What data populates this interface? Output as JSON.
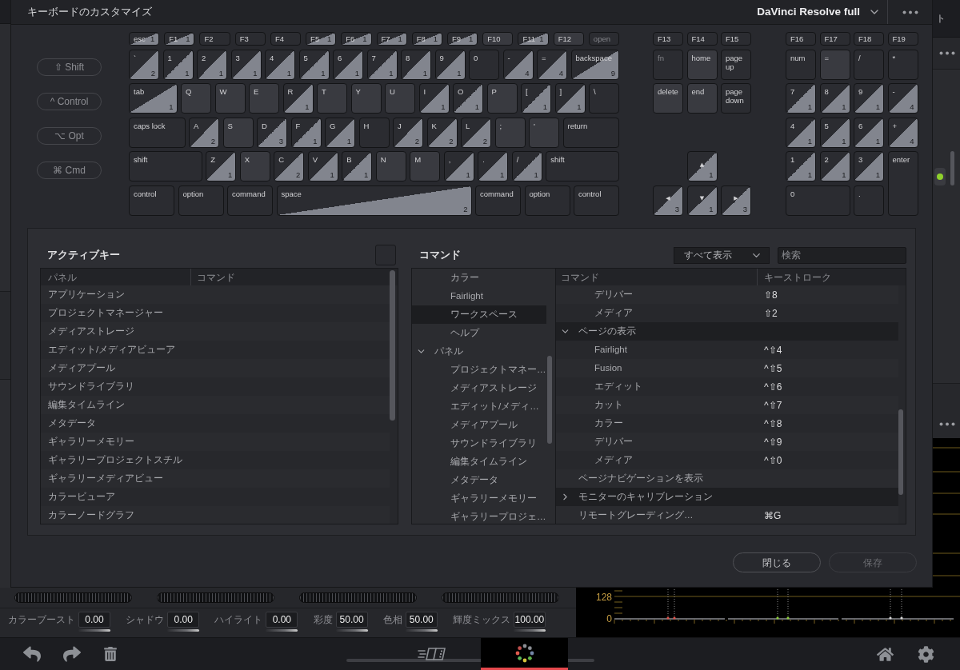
{
  "dialog": {
    "title": "キーボードのカスタマイズ",
    "preset": "DaVinci Resolve full",
    "modifiers": [
      {
        "label": "⇧ Shift",
        "selected": false
      },
      {
        "label": "^ Control",
        "selected": false
      },
      {
        "label": "⌥ Opt",
        "selected": false
      },
      {
        "label": "⌘ Cmd",
        "selected": false
      }
    ],
    "keyboard": {
      "main_rows": [
        [
          {
            "label": "esc",
            "kind": "mapped",
            "count": "1"
          },
          {
            "label": "F1",
            "kind": "mapped",
            "count": "1"
          },
          {
            "label": "F2",
            "kind": "plain"
          },
          {
            "label": "F3",
            "kind": "plain"
          },
          {
            "label": "F4",
            "kind": "plain"
          },
          {
            "label": "F5",
            "kind": "mapped",
            "count": "1"
          },
          {
            "label": "F6",
            "kind": "mapped",
            "count": "1"
          },
          {
            "label": "F7",
            "kind": "mapped",
            "count": "1"
          },
          {
            "label": "F8",
            "kind": "mapped",
            "count": "1"
          },
          {
            "label": "F9",
            "kind": "mapped",
            "count": "1"
          },
          {
            "label": "F10",
            "kind": "lit"
          },
          {
            "label": "F11",
            "kind": "mapped",
            "count": "1"
          },
          {
            "label": "F12",
            "kind": "lit"
          },
          {
            "label": "open",
            "kind": "off"
          }
        ],
        [
          {
            "label": "`",
            "kind": "mapped",
            "count": "2"
          },
          {
            "label": "1",
            "kind": "mapped",
            "count": "1"
          },
          {
            "label": "2",
            "kind": "mapped",
            "count": "1"
          },
          {
            "label": "3",
            "kind": "mapped",
            "count": "1"
          },
          {
            "label": "4",
            "kind": "mapped",
            "count": "1"
          },
          {
            "label": "5",
            "kind": "mapped",
            "count": "1"
          },
          {
            "label": "6",
            "kind": "mapped",
            "count": "1"
          },
          {
            "label": "7",
            "kind": "mapped",
            "count": "1"
          },
          {
            "label": "8",
            "kind": "mapped",
            "count": "1"
          },
          {
            "label": "9",
            "kind": "mapped",
            "count": "1"
          },
          {
            "label": "0",
            "kind": "plain"
          },
          {
            "label": "-",
            "kind": "mapped",
            "count": "4"
          },
          {
            "label": "=",
            "kind": "mapped",
            "count": "4"
          },
          {
            "label": "backspace",
            "kind": "mapped",
            "count": "9"
          }
        ],
        [
          {
            "label": "tab",
            "kind": "mapped",
            "count": "1"
          },
          {
            "label": "Q",
            "kind": "lit"
          },
          {
            "label": "W",
            "kind": "lit"
          },
          {
            "label": "E",
            "kind": "lit"
          },
          {
            "label": "R",
            "kind": "mapped",
            "count": "1"
          },
          {
            "label": "T",
            "kind": "lit"
          },
          {
            "label": "Y",
            "kind": "lit"
          },
          {
            "label": "U",
            "kind": "lit"
          },
          {
            "label": "I",
            "kind": "mapped",
            "count": "1"
          },
          {
            "label": "O",
            "kind": "mapped",
            "count": "1"
          },
          {
            "label": "P",
            "kind": "lit"
          },
          {
            "label": "[",
            "kind": "mapped",
            "count": "1"
          },
          {
            "label": "]",
            "kind": "mapped",
            "count": "1"
          },
          {
            "label": "\\",
            "kind": "plain"
          }
        ],
        [
          {
            "label": "caps lock",
            "kind": "plain"
          },
          {
            "label": "A",
            "kind": "mapped",
            "count": "2"
          },
          {
            "label": "S",
            "kind": "lit"
          },
          {
            "label": "D",
            "kind": "mapped",
            "count": "3"
          },
          {
            "label": "F",
            "kind": "mapped",
            "count": "1"
          },
          {
            "label": "G",
            "kind": "mapped",
            "count": "1"
          },
          {
            "label": "H",
            "kind": "plain"
          },
          {
            "label": "J",
            "kind": "mapped",
            "count": "2"
          },
          {
            "label": "K",
            "kind": "mapped",
            "count": "2"
          },
          {
            "label": "L",
            "kind": "mapped",
            "count": "2"
          },
          {
            "label": ";",
            "kind": "lit"
          },
          {
            "label": "'",
            "kind": "lit"
          },
          {
            "label": "return",
            "kind": "plain"
          }
        ],
        [
          {
            "label": "shift",
            "kind": "plain"
          },
          {
            "label": "Z",
            "kind": "mapped",
            "count": "1"
          },
          {
            "label": "X",
            "kind": "lit"
          },
          {
            "label": "C",
            "kind": "mapped",
            "count": "2"
          },
          {
            "label": "V",
            "kind": "mapped",
            "count": "1"
          },
          {
            "label": "B",
            "kind": "mapped",
            "count": "1"
          },
          {
            "label": "N",
            "kind": "lit"
          },
          {
            "label": "M",
            "kind": "lit"
          },
          {
            "label": ",",
            "kind": "mapped",
            "count": "1"
          },
          {
            "label": ".",
            "kind": "mapped",
            "count": "1"
          },
          {
            "label": "/",
            "kind": "mapped",
            "count": "1"
          },
          {
            "label": "shift",
            "kind": "plain"
          }
        ],
        [
          {
            "label": "control",
            "kind": "plain"
          },
          {
            "label": "option",
            "kind": "plain"
          },
          {
            "label": "command",
            "kind": "plain"
          },
          {
            "label": "space",
            "kind": "mapped",
            "count": "2"
          },
          {
            "label": "command",
            "kind": "plain"
          },
          {
            "label": "option",
            "kind": "plain"
          },
          {
            "label": "control",
            "kind": "plain"
          }
        ]
      ],
      "nav_keys": [
        {
          "label": "F13",
          "kind": "plain"
        },
        {
          "label": "F14",
          "kind": "plain"
        },
        {
          "label": "F15",
          "kind": "plain"
        },
        {
          "label": "fn",
          "kind": "off"
        },
        {
          "label": "home",
          "kind": "lit"
        },
        {
          "label": "page up",
          "kind": "plain"
        },
        {
          "label": "delete",
          "kind": "lit"
        },
        {
          "label": "end",
          "kind": "lit"
        },
        {
          "label": "page down",
          "kind": "plain"
        }
      ],
      "arrow_keys": [
        {
          "label": "▲",
          "kind": "mapped",
          "count": "1"
        },
        {
          "label": "◀",
          "kind": "mapped",
          "count": "3"
        },
        {
          "label": "▼",
          "kind": "mapped",
          "count": "1"
        },
        {
          "label": "▶",
          "kind": "mapped",
          "count": "3"
        }
      ],
      "keypad_keys": [
        {
          "label": "F16",
          "kind": "plain"
        },
        {
          "label": "F17",
          "kind": "plain"
        },
        {
          "label": "F18",
          "kind": "plain"
        },
        {
          "label": "F19",
          "kind": "plain"
        },
        {
          "label": "num",
          "kind": "plain"
        },
        {
          "label": "=",
          "kind": "lit"
        },
        {
          "label": "/",
          "kind": "plain"
        },
        {
          "label": "*",
          "kind": "plain"
        },
        {
          "label": "7",
          "kind": "mapped",
          "count": "1"
        },
        {
          "label": "8",
          "kind": "mapped",
          "count": "1"
        },
        {
          "label": "9",
          "kind": "mapped",
          "count": "1"
        },
        {
          "label": "-",
          "kind": "mapped",
          "count": "4"
        },
        {
          "label": "4",
          "kind": "mapped",
          "count": "1"
        },
        {
          "label": "5",
          "kind": "mapped",
          "count": "1"
        },
        {
          "label": "6",
          "kind": "mapped",
          "count": "1"
        },
        {
          "label": "+",
          "kind": "mapped",
          "count": "4"
        },
        {
          "label": "1",
          "kind": "mapped",
          "count": "1"
        },
        {
          "label": "2",
          "kind": "mapped",
          "count": "1"
        },
        {
          "label": "3",
          "kind": "mapped",
          "count": "1"
        },
        {
          "label": "enter",
          "kind": "plain"
        },
        {
          "label": "0",
          "kind": "plain"
        },
        {
          "label": ".",
          "kind": "plain"
        }
      ]
    },
    "active_keys": {
      "title": "アクティブキー",
      "columns": [
        "パネル",
        "コマンド"
      ],
      "rows": [
        "アプリケーション",
        "プロジェクトマネージャー",
        "メディアストレージ",
        "エディット/メディアビューア",
        "メディアプール",
        "サウンドライブラリ",
        "編集タイムライン",
        "メタデータ",
        "ギャラリーメモリー",
        "ギャラリープロジェクトスチル",
        "ギャラリーメディアビュー",
        "カラービューア",
        "カラーノードグラフ"
      ]
    },
    "commands": {
      "title": "コマンド",
      "filter": "すべて表示",
      "search": {
        "placeholder": "検索"
      },
      "tree": [
        {
          "kind": "group",
          "expanded": true,
          "children": [
            {
              "kind": "item",
              "label": "カラー",
              "selected": false
            },
            {
              "kind": "item",
              "label": "Fairlight",
              "selected": false
            },
            {
              "kind": "item",
              "label": "ワークスペース",
              "selected": true
            },
            {
              "kind": "item",
              "label": "ヘルプ",
              "selected": false
            }
          ]
        },
        {
          "kind": "group",
          "label": "パネル",
          "expanded": true,
          "selected": false,
          "children": [
            {
              "kind": "item",
              "label": "プロジェクトマネー…",
              "selected": false
            },
            {
              "kind": "item",
              "label": "メディアストレージ",
              "selected": false
            },
            {
              "kind": "item",
              "label": "エディット/メディ…",
              "selected": false
            },
            {
              "kind": "item",
              "label": "メディアプール",
              "selected": false
            },
            {
              "kind": "item",
              "label": "サウンドライブラリ",
              "selected": false
            },
            {
              "kind": "item",
              "label": "編集タイムライン",
              "selected": false
            },
            {
              "kind": "item",
              "label": "メタデータ",
              "selected": false
            },
            {
              "kind": "item",
              "label": "ギャラリーメモリー",
              "selected": false
            },
            {
              "kind": "item",
              "label": "ギャラリープロジェ…",
              "selected": false
            }
          ]
        }
      ],
      "columns": [
        "コマンド",
        "キーストローク"
      ],
      "rows": [
        {
          "kind": "group",
          "expanded": true,
          "children": [
            {
              "kind": "item",
              "command": "デリバー",
              "keystroke": "⇧8"
            },
            {
              "kind": "item",
              "command": "メディア",
              "keystroke": "⇧2"
            }
          ]
        },
        {
          "kind": "group",
          "command": "ページの表示",
          "expanded": true,
          "children": [
            {
              "kind": "item",
              "command": "Fairlight",
              "keystroke": "^⇧4"
            },
            {
              "kind": "item",
              "command": "Fusion",
              "keystroke": "^⇧5"
            },
            {
              "kind": "item",
              "command": "エディット",
              "keystroke": "^⇧6"
            },
            {
              "kind": "item",
              "command": "カット",
              "keystroke": "^⇧7"
            },
            {
              "kind": "item",
              "command": "カラー",
              "keystroke": "^⇧8"
            },
            {
              "kind": "item",
              "command": "デリバー",
              "keystroke": "^⇧9"
            },
            {
              "kind": "item",
              "command": "メディア",
              "keystroke": "^⇧0"
            }
          ]
        },
        {
          "kind": "item",
          "command": "ページナビゲーションを表示"
        },
        {
          "kind": "group",
          "command": "モニターのキャリブレーション",
          "expanded": false
        },
        {
          "kind": "item",
          "command": "リモートグレーディング…",
          "keystroke": "⌘G"
        }
      ]
    },
    "buttons": [
      {
        "label": "閉じる",
        "disabled": false
      },
      {
        "label": "保存",
        "disabled": true
      }
    ]
  },
  "right_panel": {
    "title_fragment": "ト"
  },
  "scope": {
    "labels": [
      "128",
      "0"
    ]
  },
  "color_panel": {
    "adjustments": [
      {
        "label": "カラーブースト",
        "value": "0.00"
      },
      {
        "label": "シャドウ",
        "value": "0.00"
      },
      {
        "label": "ハイライト",
        "value": "0.00"
      },
      {
        "label": "彩度",
        "value": "50.00"
      },
      {
        "label": "色相",
        "value": "50.00"
      },
      {
        "label": "輝度ミックス",
        "value": "100.00"
      }
    ]
  },
  "toolbar": {
    "pages": [
      {
        "kind": "cut",
        "selected": false
      },
      {
        "kind": "color",
        "selected": true
      }
    ]
  }
}
